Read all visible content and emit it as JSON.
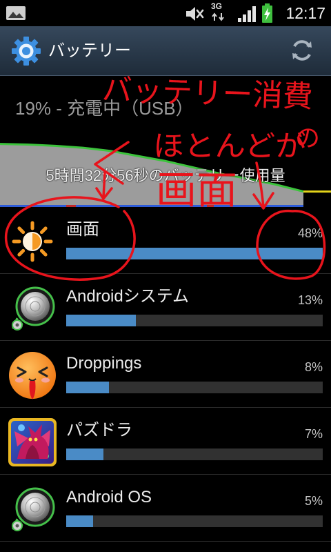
{
  "status_bar": {
    "time": "12:17",
    "network_type": "3G",
    "left_icon": "gallery-notification-icon",
    "right_icons": [
      "mute-icon",
      "data-activity-icon",
      "signal-strength-icon",
      "battery-charging-icon"
    ]
  },
  "header": {
    "title": "バッテリー",
    "app_icon": "settings-gear-icon",
    "action_icon": "refresh-icon"
  },
  "summary": {
    "status": "19% - 充電中（USB）"
  },
  "battery_graph": {
    "label": "5時間32分56秒のバッテリー使用量",
    "discharge_levels": [
      95,
      94,
      92,
      89,
      84,
      76,
      68,
      58,
      48,
      40,
      31,
      20
    ],
    "charging_levels": [
      20,
      20
    ],
    "fill_color": "#9c9c9c",
    "level_line_color": "#3cc43c",
    "charging_line_color": "#e2d21a"
  },
  "usage_items": [
    {
      "label": "画面",
      "percent": "48%",
      "icon": "brightness-icon"
    },
    {
      "label": "Androidシステム",
      "percent": "13%",
      "icon": "android-system-icon"
    },
    {
      "label": "Droppings",
      "percent": "8%",
      "icon": "droppings-app-icon"
    },
    {
      "label": "パズドラ",
      "percent": "7%",
      "icon": "puzzle-dragons-app-icon"
    },
    {
      "label": "Android OS",
      "percent": "5%",
      "icon": "android-os-icon"
    }
  ],
  "bar_fill_color": "#4a8bc6",
  "annotation": {
    "color": "#e8141c",
    "lines": [
      "バッテリー消費",
      "の",
      "ほとんどが",
      "画面"
    ]
  }
}
